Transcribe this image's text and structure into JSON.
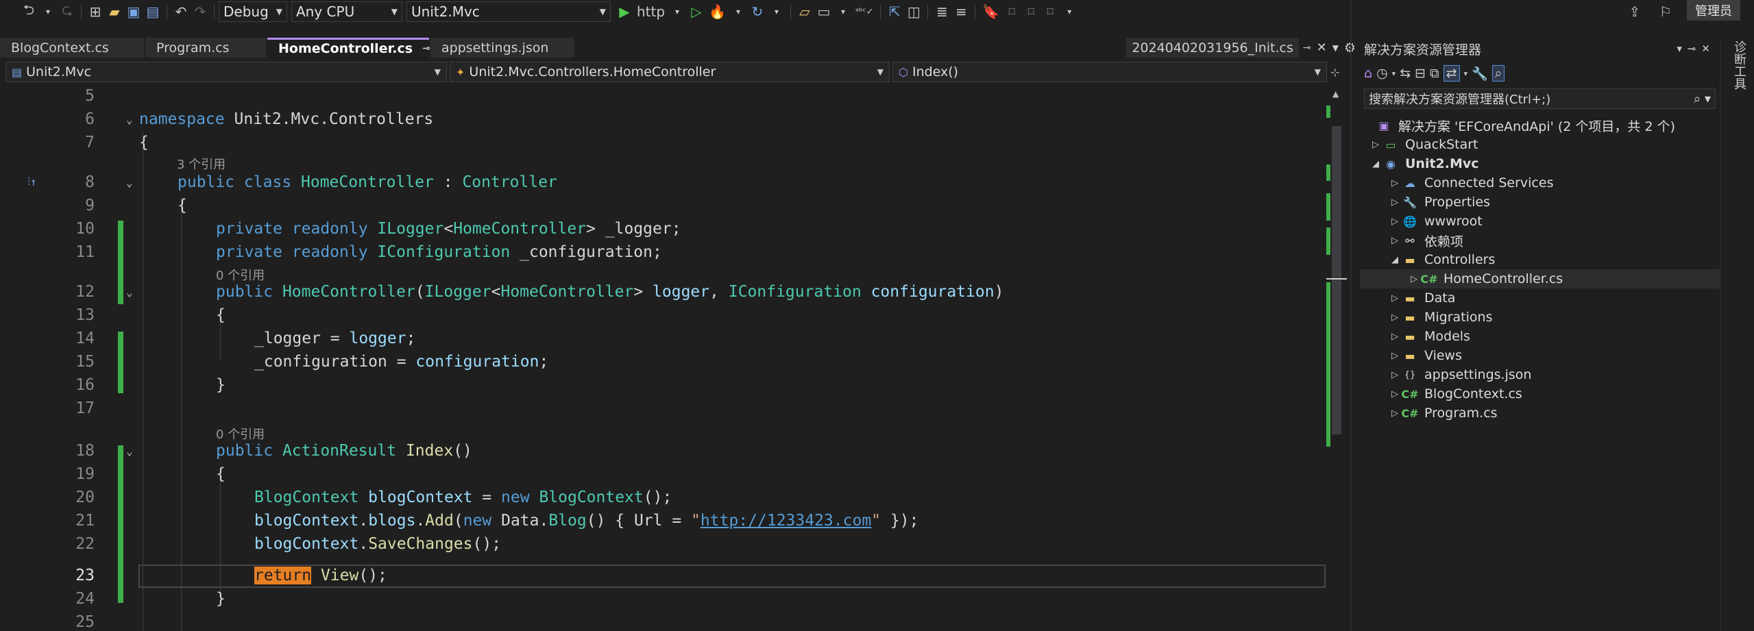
{
  "toolbar": {
    "config": "Debug",
    "platform": "Any CPU",
    "startup_project": "Unit2.Mvc",
    "run_profile": "http",
    "admin_label": "管理员"
  },
  "tabs": [
    {
      "label": "BlogContext.cs",
      "active": false
    },
    {
      "label": "Program.cs",
      "active": false
    },
    {
      "label": "HomeController.cs",
      "active": true
    },
    {
      "label": "appsettings.json",
      "active": false
    }
  ],
  "preview_tab": {
    "label": "20240402031956_Init.cs"
  },
  "navbar": {
    "project": "Unit2.Mvc",
    "type": "Unit2.Mvc.Controllers.HomeController",
    "member": "Index()"
  },
  "editor": {
    "current_line": "23",
    "lines": [
      {
        "n": "5"
      },
      {
        "n": "6"
      },
      {
        "n": "7"
      },
      {
        "n": "8"
      },
      {
        "n": "9"
      },
      {
        "n": "10"
      },
      {
        "n": "11"
      },
      {
        "n": "12"
      },
      {
        "n": "13"
      },
      {
        "n": "14"
      },
      {
        "n": "15"
      },
      {
        "n": "16"
      },
      {
        "n": "17"
      },
      {
        "n": "18"
      },
      {
        "n": "19"
      },
      {
        "n": "20"
      },
      {
        "n": "21"
      },
      {
        "n": "22"
      },
      {
        "n": "23"
      },
      {
        "n": "24"
      },
      {
        "n": "25"
      }
    ],
    "code": {
      "l6_kw": "namespace",
      "l6_name": " Unit2.Mvc.Controllers",
      "l7": "{",
      "lens_class": "3 个引用",
      "l8_kw": "public class ",
      "l8_name": "HomeController",
      "l8_colon": " : ",
      "l8_base": "Controller",
      "l9": "{",
      "l10_kw": "private readonly ",
      "l10_type": "ILogger",
      "l10_lt": "<",
      "l10_targ": "HomeController",
      "l10_gt": "> ",
      "l10_field": "_logger",
      "l10_semi": ";",
      "l11_kw": "private readonly ",
      "l11_type": "IConfiguration",
      "l11_field": " _configuration",
      "l11_semi": ";",
      "lens_ctor": "0 个引用",
      "l12_kw": "public ",
      "l12_name": "HomeController",
      "l12_p1": "(",
      "l12_t1": "ILogger",
      "l12_p2": "<",
      "l12_t2": "HomeController",
      "l12_p3": "> ",
      "l12_a1": "logger",
      "l12_p4": ", ",
      "l12_t3": "IConfiguration",
      "l12_p5": " ",
      "l12_a2": "configuration",
      "l12_p6": ")",
      "l13": "{",
      "l14_f": "_logger",
      "l14_eq": " = ",
      "l14_v": "logger",
      "l14_semi": ";",
      "l15_f": "_configuration",
      "l15_eq": " = ",
      "l15_v": "configuration",
      "l15_semi": ";",
      "l16": "}",
      "lens_index": "0 个引用",
      "l18_kw": "public ",
      "l18_type": "ActionResult",
      "l18_name": " Index",
      "l18_p": "()",
      "l19": "{",
      "l20_type": "BlogContext",
      "l20_var": " blogContext",
      "l20_eq": " = ",
      "l20_new": "new ",
      "l20_type2": "BlogContext",
      "l20_end": "();",
      "l21_var": "blogContext",
      "l21_dot": ".",
      "l21_prop": "blogs",
      "l21_dot2": ".",
      "l21_m": "Add",
      "l21_p1": "(",
      "l21_new": "new ",
      "l21_ns": "Data.",
      "l21_type": "Blog",
      "l21_p2": "() { Url = ",
      "l21_q1": "\"",
      "l21_url": "http://1233423.com",
      "l21_q2": "\"",
      "l21_end": " });",
      "l22_var": "blogContext",
      "l22_dot": ".",
      "l22_m": "SaveChanges",
      "l22_end": "();",
      "l23_kw": "return",
      "l23_m": " View",
      "l23_end": "();",
      "l24": "}"
    }
  },
  "solution_explorer": {
    "title": "解决方案资源管理器",
    "search_placeholder": "搜索解决方案资源管理器(Ctrl+;)",
    "items": [
      {
        "label": "解决方案 'EFCoreAndApi' (2 个项目，共 2 个)"
      },
      {
        "label": "QuackStart"
      },
      {
        "label": "Unit2.Mvc"
      },
      {
        "label": "Connected Services"
      },
      {
        "label": "Properties"
      },
      {
        "label": "wwwroot"
      },
      {
        "label": "依赖项"
      },
      {
        "label": "Controllers"
      },
      {
        "label": "HomeController.cs"
      },
      {
        "label": "Data"
      },
      {
        "label": "Migrations"
      },
      {
        "label": "Models"
      },
      {
        "label": "Views"
      },
      {
        "label": "appsettings.json"
      },
      {
        "label": "BlogContext.cs"
      },
      {
        "label": "Program.cs"
      }
    ]
  },
  "side_panel": {
    "label": "诊断工具"
  },
  "colors": {
    "keyword": "#569cd6",
    "type": "#4ec9b0",
    "method": "#dcdcaa",
    "variable": "#9cdcfe",
    "string": "#d69d85",
    "change_bar": "#3fae4a",
    "highlight": "#e67e22"
  }
}
